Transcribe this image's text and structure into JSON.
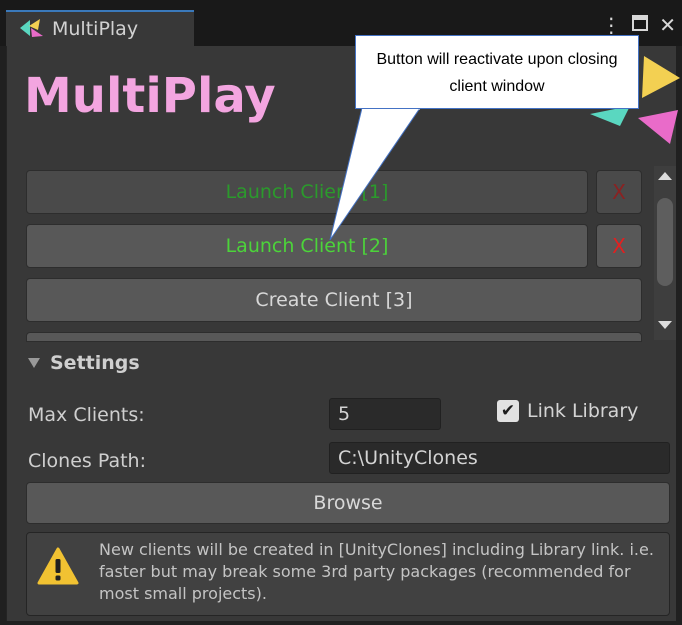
{
  "window": {
    "tab_title": "MultiPlay",
    "controls": [
      "more-vert-icon",
      "maximize-icon",
      "close-icon"
    ]
  },
  "header": {
    "logo_text": "MultiPlay",
    "logo_color": "#f3a5e0"
  },
  "annotation": {
    "callout_text": "Button will reactivate upon closing client window"
  },
  "clients": [
    {
      "label": "Launch Client [1]",
      "state": "disabled",
      "remove_label": "X"
    },
    {
      "label": "Launch Client [2]",
      "state": "active",
      "remove_label": "X"
    },
    {
      "label": "Create Client [3]",
      "state": "normal"
    }
  ],
  "settings": {
    "header": "Settings",
    "max_clients_label": "Max Clients:",
    "max_clients_value": "5",
    "link_library_label": "Link Library",
    "link_library_checked": true,
    "clones_path_label": "Clones Path:",
    "clones_path_value": "C:\\UnityClones",
    "browse_label": "Browse"
  },
  "help_box": {
    "icon": "warning-icon",
    "text": "New clients will be created in [UnityClones] including Library link. i.e. faster but may break some 3rd party packages (recommended for most small projects)."
  },
  "colors": {
    "active_client_text": "#4cd43a",
    "remove_x": "#e02020",
    "panel_bg": "#383838",
    "button_bg": "#585858"
  }
}
